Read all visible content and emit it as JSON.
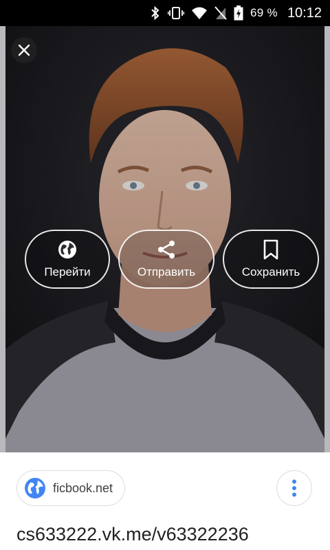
{
  "status_bar": {
    "battery_percent": "69 %",
    "time": "10:12",
    "icons": [
      "bluetooth-icon",
      "vibrate-icon",
      "wifi-icon",
      "no-sim-icon",
      "battery-charging-icon"
    ]
  },
  "viewer": {
    "close_icon": "close-icon",
    "actions": [
      {
        "label": "Перейти",
        "icon": "globe-icon"
      },
      {
        "label": "Отправить",
        "icon": "share-icon"
      },
      {
        "label": "Сохранить",
        "icon": "bookmark-icon"
      }
    ]
  },
  "bottom": {
    "source_label": "ficbook.net",
    "source_icon": "globe-icon",
    "more_icon": "more-vert-icon",
    "url": "cs633222.vk.me/v63322236"
  },
  "colors": {
    "accent": "#4285f4",
    "status_bar": "#000000",
    "photo_background": "#1a1a1e"
  }
}
